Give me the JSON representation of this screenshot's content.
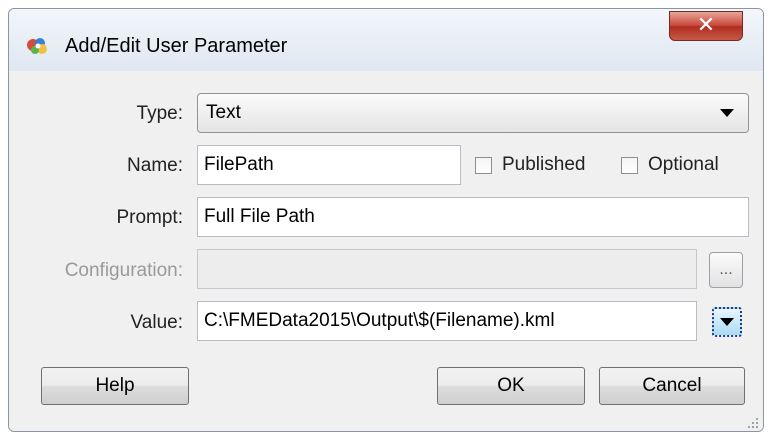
{
  "window": {
    "title": "Add/Edit User Parameter",
    "close_icon": "close-icon"
  },
  "form": {
    "type_label": "Type:",
    "type_value": "Text",
    "name_label": "Name:",
    "name_value": "FilePath",
    "published_label": "Published",
    "optional_label": "Optional",
    "prompt_label": "Prompt:",
    "prompt_value": "Full File Path",
    "configuration_label": "Configuration:",
    "configuration_value": "",
    "configuration_browse": "...",
    "value_label": "Value:",
    "value_value": "C:\\FMEData2015\\Output\\$(Filename).kml"
  },
  "buttons": {
    "help": "Help",
    "ok": "OK",
    "cancel": "Cancel"
  }
}
